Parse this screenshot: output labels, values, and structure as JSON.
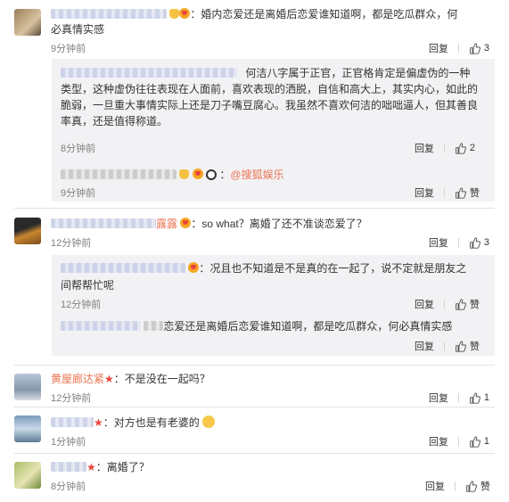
{
  "comments": [
    {
      "user_blur": true,
      "text": "婚内恋爱还是离婚后恋爱谁知道啊，都是吃瓜群众，何必真情实感",
      "text_line1": "：婚内恋爱还是离婚后恋爱谁知道啊，都是吃瓜群众，何",
      "text_line2": "必真情实感",
      "time": "9分钟前",
      "reply_label": "回复",
      "like_count": "3",
      "replies": [
        {
          "line1": "何洁八字属于正官，正官格肯定是偏虚伪的一种",
          "line2": "类型，这种虚伪往往表现在人面前，喜欢表现的洒脱，自信和高大上，其实内心，如此的",
          "line3": "脆弱，一旦重大事情实际上还是刀子嘴豆腐心。我虽然不喜欢何洁的咄咄逼人，但其善良",
          "line4": "率真，还是值得称道。",
          "time": "8分钟前",
          "reply_label": "回复",
          "like_count": "2"
        }
      ],
      "via": "@搜狐娱乐",
      "via_time": "9分钟前",
      "via_reply": "回复",
      "via_like": "赞"
    },
    {
      "user_name": "露露",
      "text": "：so what？离婚了还不准谈恋爱了？",
      "time": "12分钟前",
      "reply_label": "回复",
      "like_count": "3",
      "replies": [
        {
          "line1": "：况且也不知道是不是真的在一起了，说不定就是朋友之",
          "line2": "间帮帮忙呢",
          "time": "12分钟前",
          "reply_label": "回复",
          "like_label": "赞"
        },
        {
          "line1": "恋爱还是离婚后恋爱谁知道啊，都是吃瓜群众，何必真情实感",
          "reply_label": "回复",
          "like_label": "赞"
        }
      ]
    },
    {
      "user_name": "黄屋廊达紧",
      "text": "：不是没在一起吗？",
      "time": "12分钟前",
      "reply_label": "回复",
      "like_count": "1"
    },
    {
      "text": "：对方也是有老婆的",
      "time": "1分钟前",
      "reply_label": "回复",
      "like_count": "1"
    },
    {
      "text": "：离婚了？",
      "time": "8分钟前",
      "reply_label": "回复",
      "like_label": "赞"
    }
  ],
  "colors": {
    "username": "#eb7350",
    "text": "#333333",
    "time": "#808080",
    "replybox_bg": "#f2f2f5"
  },
  "icons": {
    "like": "thumbs-up-icon",
    "vip": "star-icon"
  }
}
